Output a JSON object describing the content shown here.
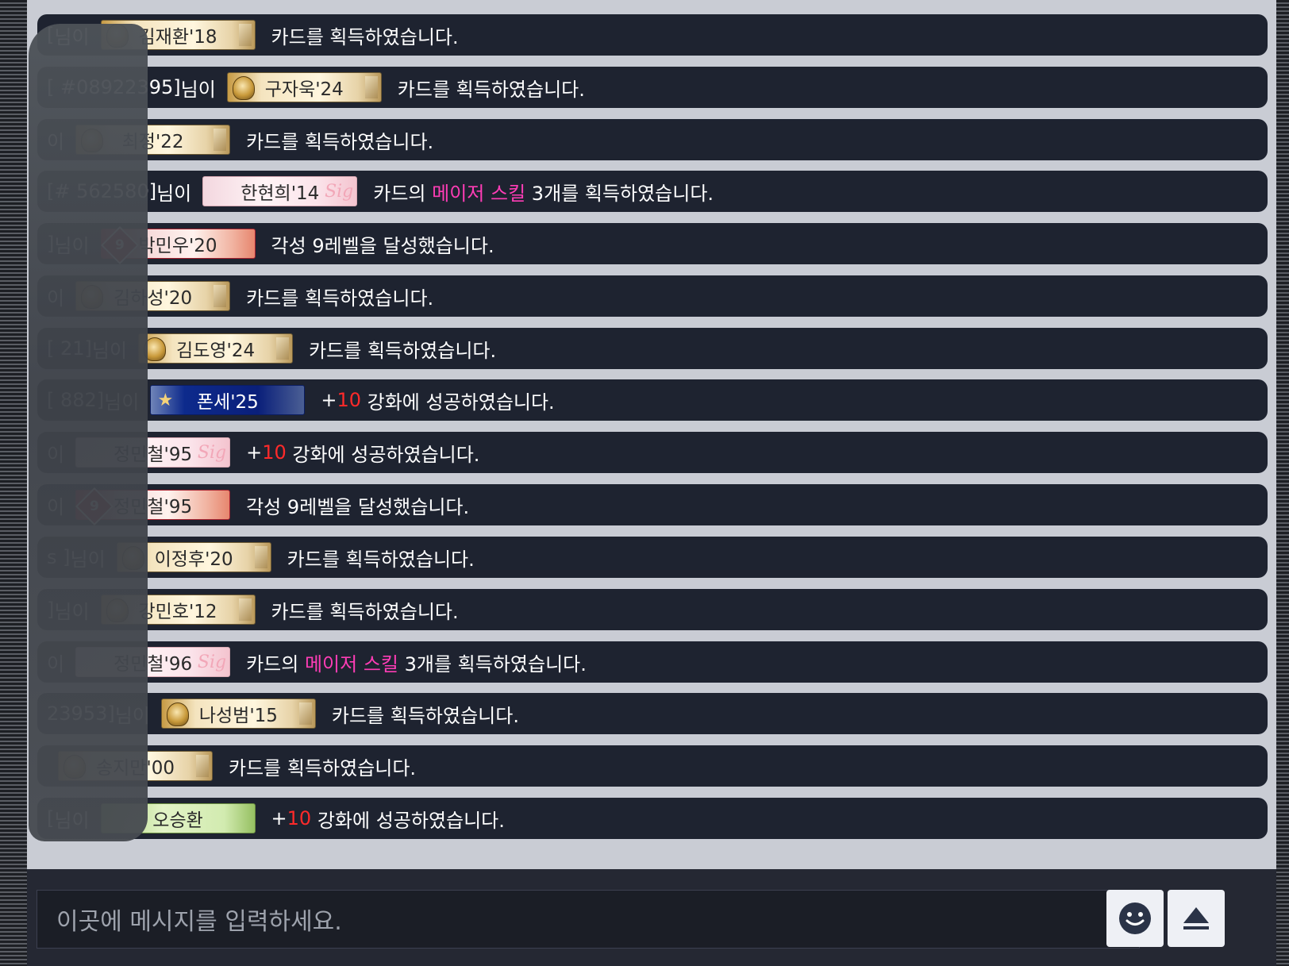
{
  "messages": [
    {
      "user": "[",
      "suffix": "님이",
      "card": {
        "name": "김재환'18",
        "style": "gold",
        "icon": "gold-trophy-icon"
      },
      "parts": [
        {
          "t": "카드를 획득하였습니다.",
          "c": "white"
        }
      ]
    },
    {
      "user": "[ #08922395]",
      "suffix": "님이",
      "card": {
        "name": "구자욱'24",
        "style": "gold",
        "icon": "gold-trophy-icon"
      },
      "parts": [
        {
          "t": "카드를 획득하였습니다.",
          "c": "white"
        }
      ]
    },
    {
      "user": "",
      "suffix": "이",
      "card": {
        "name": "최정'22",
        "style": "gold",
        "icon": "gold-trophy-icon"
      },
      "parts": [
        {
          "t": "카드를 획득하였습니다.",
          "c": "white"
        }
      ]
    },
    {
      "user": "[#  562580]",
      "suffix": "님이",
      "card": {
        "name": "한현희'14",
        "style": "sig",
        "icon": "signature-icon"
      },
      "parts": [
        {
          "t": "카드의 ",
          "c": "white"
        },
        {
          "t": "메이저 스킬",
          "c": "pink"
        },
        {
          "t": " 3개를 획득하였습니다.",
          "c": "white"
        }
      ]
    },
    {
      "user": "]",
      "suffix": "님이",
      "card": {
        "name": "박민우'20",
        "style": "awk",
        "icon": "awakening-level-icon",
        "level": "9"
      },
      "parts": [
        {
          "t": "각성 9레벨을 달성했습니다.",
          "c": "white"
        }
      ]
    },
    {
      "user": "",
      "suffix": "이",
      "card": {
        "name": "김하성'20",
        "style": "gold",
        "icon": "gold-trophy-icon"
      },
      "parts": [
        {
          "t": "카드를 획득하였습니다.",
          "c": "white"
        }
      ]
    },
    {
      "user": "[     21]",
      "suffix": "님이",
      "card": {
        "name": "김도영'24",
        "style": "gold",
        "icon": "gold-trophy-icon"
      },
      "parts": [
        {
          "t": "카드를 획득하였습니다.",
          "c": "white"
        }
      ]
    },
    {
      "user": "[   882]",
      "suffix": "님이",
      "card": {
        "name": "폰세'25",
        "style": "blue",
        "icon": "blue-star-icon"
      },
      "parts": [
        {
          "t": "+",
          "c": "white"
        },
        {
          "t": "10",
          "c": "red"
        },
        {
          "t": " 강화에 성공하였습니다.",
          "c": "white"
        }
      ]
    },
    {
      "user": "",
      "suffix": "이",
      "card": {
        "name": "정민철'95",
        "style": "sig",
        "icon": "signature-icon"
      },
      "parts": [
        {
          "t": "+",
          "c": "white"
        },
        {
          "t": "10",
          "c": "red"
        },
        {
          "t": " 강화에 성공하였습니다.",
          "c": "white"
        }
      ]
    },
    {
      "user": "",
      "suffix": "이",
      "card": {
        "name": "정민철'95",
        "style": "awk",
        "icon": "awakening-level-icon",
        "level": "9"
      },
      "parts": [
        {
          "t": "각성 9레벨을 달성했습니다.",
          "c": "white"
        }
      ]
    },
    {
      "user": "s   ]",
      "suffix": "님이",
      "card": {
        "name": "이정후'20",
        "style": "gold",
        "icon": "gold-trophy-icon"
      },
      "parts": [
        {
          "t": "카드를 획득하였습니다.",
          "c": "white"
        }
      ]
    },
    {
      "user": "]",
      "suffix": "님이",
      "card": {
        "name": "강민호'12",
        "style": "gold",
        "icon": "gold-trophy-icon"
      },
      "parts": [
        {
          "t": "카드를 획득하였습니다.",
          "c": "white"
        }
      ]
    },
    {
      "user": "",
      "suffix": "이",
      "card": {
        "name": "정민철'96",
        "style": "sig",
        "icon": "signature-icon"
      },
      "parts": [
        {
          "t": "카드의 ",
          "c": "white"
        },
        {
          "t": "메이저 스킬",
          "c": "pink"
        },
        {
          "t": " 3개를 획득하였습니다.",
          "c": "white"
        }
      ]
    },
    {
      "user": "23953]",
      "suffix": "님이",
      "card": {
        "name": "나성범'15",
        "style": "gold",
        "icon": "gold-trophy-icon"
      },
      "parts": [
        {
          "t": "카드를 획득하였습니다.",
          "c": "white"
        }
      ]
    },
    {
      "user": "",
      "suffix": "",
      "card": {
        "name": "송지만'00",
        "style": "gold",
        "icon": "gold-trophy-icon"
      },
      "parts": [
        {
          "t": "카드를 획득하였습니다.",
          "c": "white"
        }
      ]
    },
    {
      "user": "[",
      "suffix": "님이",
      "card": {
        "name": "오승환",
        "style": "green",
        "icon": "green-card-icon"
      },
      "parts": [
        {
          "t": "+",
          "c": "white"
        },
        {
          "t": "10",
          "c": "red"
        },
        {
          "t": " 강화에 성공하였습니다.",
          "c": "white"
        }
      ]
    }
  ],
  "colors": {
    "pink": "#ff3db6",
    "red": "#ff2a2a",
    "white": "#ffffff"
  },
  "input": {
    "placeholder": "이곳에 메시지를 입력하세요."
  },
  "buttons": {
    "emoji_icon": "smiley-face-icon",
    "send_icon": "eject-up-arrow-icon"
  }
}
